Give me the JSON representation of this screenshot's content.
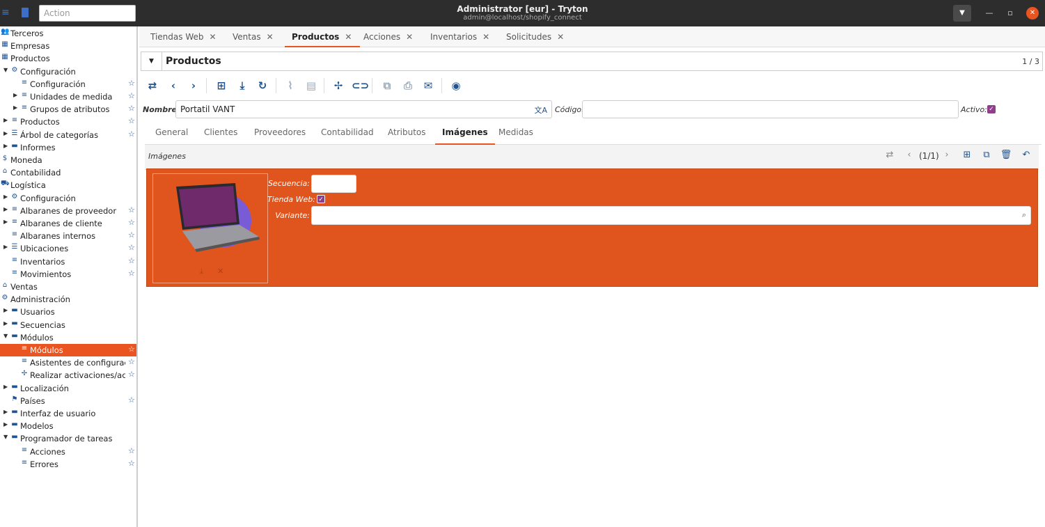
{
  "window": {
    "title": "Administrator [eur] - Tryton",
    "subtitle": "admin@localhost/shopify_connect",
    "action_placeholder": "Action"
  },
  "sidebar": [
    {
      "label": "Terceros",
      "icon": "people-icon",
      "level": 0
    },
    {
      "label": "Empresas",
      "icon": "company-icon",
      "level": 0
    },
    {
      "label": "Productos",
      "icon": "grid-icon",
      "level": 0
    },
    {
      "label": "Configuración",
      "icon": "gear-icon",
      "level": 1,
      "arrow": "down"
    },
    {
      "label": "Configuración",
      "icon": "list-icon",
      "level": 2,
      "star": true
    },
    {
      "label": "Unidades de medida",
      "icon": "list-icon",
      "level": 2,
      "arrow": "right",
      "star": true
    },
    {
      "label": "Grupos de atributos",
      "icon": "list-icon",
      "level": 2,
      "arrow": "right",
      "star": true
    },
    {
      "label": "Productos",
      "icon": "list-icon",
      "level": 1,
      "arrow": "right",
      "star": true
    },
    {
      "label": "Árbol de categorías",
      "icon": "tree-list-icon",
      "level": 1,
      "arrow": "right",
      "star": true
    },
    {
      "label": "Informes",
      "icon": "folder-icon",
      "level": 1,
      "arrow": "right"
    },
    {
      "label": "Moneda",
      "icon": "dollar-icon",
      "level": 0
    },
    {
      "label": "Contabilidad",
      "icon": "bank-icon",
      "level": 0
    },
    {
      "label": "Logística",
      "icon": "truck-icon",
      "level": 0
    },
    {
      "label": "Configuración",
      "icon": "gear-icon",
      "level": 1,
      "arrow": "right"
    },
    {
      "label": "Albaranes de proveedor",
      "icon": "list-icon",
      "level": 1,
      "arrow": "right",
      "star": true
    },
    {
      "label": "Albaranes de cliente",
      "icon": "list-icon",
      "level": 1,
      "arrow": "right",
      "star": true
    },
    {
      "label": "Albaranes internos",
      "icon": "list-icon",
      "level": 1,
      "star": true
    },
    {
      "label": "Ubicaciones",
      "icon": "tree-list-icon",
      "level": 1,
      "arrow": "right",
      "star": true
    },
    {
      "label": "Inventarios",
      "icon": "list-icon",
      "level": 1,
      "star": true
    },
    {
      "label": "Movimientos",
      "icon": "list-icon",
      "level": 1,
      "star": true
    },
    {
      "label": "Ventas",
      "icon": "shop-icon",
      "level": 0
    },
    {
      "label": "Administración",
      "icon": "gear-icon",
      "level": 0
    },
    {
      "label": "Usuarios",
      "icon": "folder-icon",
      "level": 1,
      "arrow": "right"
    },
    {
      "label": "Secuencias",
      "icon": "folder-icon",
      "level": 1,
      "arrow": "right"
    },
    {
      "label": "Módulos",
      "icon": "folder-icon",
      "level": 1,
      "arrow": "down"
    },
    {
      "label": "Módulos",
      "icon": "list-icon",
      "level": 2,
      "star": true,
      "selected": true
    },
    {
      "label": "Asistentes de configuración",
      "icon": "list-icon",
      "level": 2,
      "star": true
    },
    {
      "label": "Realizar activaciones/actualizaciones",
      "icon": "wizard-icon",
      "level": 2,
      "star": true
    },
    {
      "label": "Localización",
      "icon": "folder-icon",
      "level": 1,
      "arrow": "right"
    },
    {
      "label": "Países",
      "icon": "flag-icon",
      "level": 1,
      "star": true
    },
    {
      "label": "Interfaz de usuario",
      "icon": "folder-icon",
      "level": 1,
      "arrow": "right"
    },
    {
      "label": "Modelos",
      "icon": "folder-icon",
      "level": 1,
      "arrow": "right"
    },
    {
      "label": "Programador de tareas",
      "icon": "folder-icon",
      "level": 1,
      "arrow": "down"
    },
    {
      "label": "Acciones",
      "icon": "list-icon",
      "level": 2,
      "star": true
    },
    {
      "label": "Errores",
      "icon": "list-icon",
      "level": 2,
      "star": true
    }
  ],
  "tabs": [
    {
      "label": "Tiendas Web",
      "active": false
    },
    {
      "label": "Ventas",
      "active": false
    },
    {
      "label": "Productos",
      "active": true
    },
    {
      "label": "Acciones",
      "active": false
    },
    {
      "label": "Inventarios",
      "active": false
    },
    {
      "label": "Solicitudes",
      "active": false
    }
  ],
  "header": {
    "title": "Productos",
    "record_count": "1 / 3"
  },
  "toolbar": [
    "switch-view-icon",
    "previous-icon",
    "next-icon",
    "new-icon",
    "save-icon",
    "reload-icon",
    "attachment-icon",
    "note-icon",
    "action-icon",
    "relate-icon",
    "open-icon",
    "print-icon",
    "email-icon",
    "web-icon"
  ],
  "form": {
    "nombre_label": "Nombre:",
    "nombre_value": "Portatil VANT",
    "codigo_label": "Código:",
    "codigo_value": "",
    "activo_label": "Activo:",
    "activo_checked": true
  },
  "subtabs": [
    {
      "label": "General",
      "active": false
    },
    {
      "label": "Clientes",
      "active": false
    },
    {
      "label": "Proveedores",
      "active": false
    },
    {
      "label": "Contabilidad",
      "active": false
    },
    {
      "label": "Atributos",
      "active": false
    },
    {
      "label": "Imágenes",
      "active": true
    },
    {
      "label": "Medidas",
      "active": false
    }
  ],
  "images": {
    "label": "Imágenes",
    "pager": "(1/1)",
    "record": {
      "secuencia_label": "Secuencia:",
      "secuencia_value": "",
      "tienda_label": "Tienda Web:",
      "tienda_checked": true,
      "variante_label": "Variante:",
      "variante_value": ""
    }
  },
  "colors": {
    "accent": "#e95420",
    "icon": "#1f5391",
    "check": "#8e3f8c"
  }
}
